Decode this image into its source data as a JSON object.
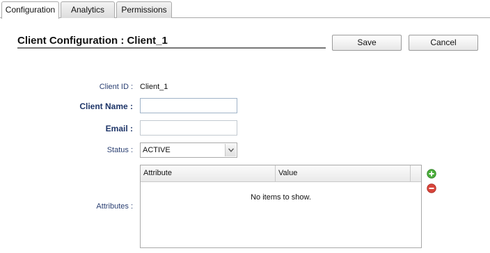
{
  "tabs": [
    {
      "label": "Configuration",
      "active": true
    },
    {
      "label": "Analytics",
      "active": false
    },
    {
      "label": "Permissions",
      "active": false
    }
  ],
  "header": {
    "title": "Client Configuration : Client_1",
    "save_label": "Save",
    "cancel_label": "Cancel"
  },
  "form": {
    "client_id_label": "Client ID :",
    "client_id_value": "Client_1",
    "client_name_label": "Client Name :",
    "client_name_value": "",
    "email_label": "Email :",
    "email_value": "",
    "status_label": "Status :",
    "status_value": "ACTIVE",
    "attributes_label": "Attributes :"
  },
  "attributes_grid": {
    "columns": [
      "Attribute",
      "Value"
    ],
    "rows": [],
    "empty_text": "No items to show."
  },
  "icons": {
    "add": "plus-circle-icon",
    "remove": "minus-circle-icon",
    "dropdown": "chevron-down-icon"
  },
  "colors": {
    "add_green": "#4caf3c",
    "remove_red": "#d9453b",
    "label_blue": "#1e3568"
  }
}
